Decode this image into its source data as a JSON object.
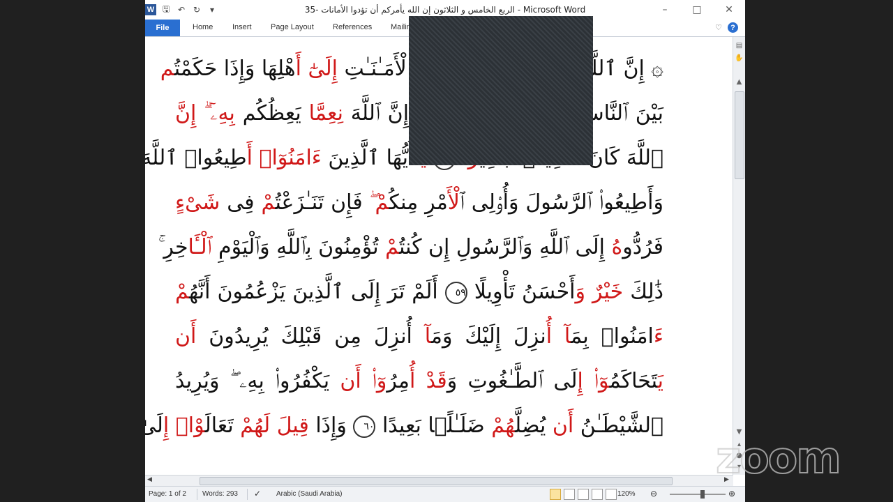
{
  "window": {
    "title": "الربع  الخامس و الثلاثون إن الله يأمركم أن تؤدوا الأمانات -35  -  Microsoft Word",
    "qat_icons": [
      "word-logo-icon",
      "save-icon",
      "undo-icon",
      "redo-icon",
      "customize-icon"
    ],
    "word_logo": "W"
  },
  "ribbon": {
    "file": "File",
    "tabs": [
      "Home",
      "Insert",
      "Page Layout",
      "References",
      "Mailings"
    ]
  },
  "document": {
    "lines": [
      {
        "spans": [
          {
            "t": "۞ إِنَّ ٱللَّهَ يَأْمُرُكُمْ أَن تُؤَدُّوا۟ ٱلْأَمَـٰنَـٰتِ ",
            "c": "k"
          },
          {
            "t": "إِلَىٰٓ أَ",
            "c": "r"
          },
          {
            "t": "هْلِهَا وَإِذَا حَكَمْتُ",
            "c": "k"
          },
          {
            "t": "م",
            "c": "r"
          }
        ]
      },
      {
        "spans": [
          {
            "t": "بَيْنَ ٱلنَّاسِ أَن تَحْكُمُوا۟ بِٱلْعَدْلِ ۚ إِنَّ ٱللَّهَ ",
            "c": "k"
          },
          {
            "t": "نِعِمَّا",
            "c": "r"
          },
          {
            "t": " يَعِظُكُم ",
            "c": "k"
          },
          {
            "t": "بِهِۦٓ ۗ إِنَّ",
            "c": "r"
          }
        ]
      },
      {
        "spans": [
          {
            "t": "ٱللَّهَ كَانَ سَمِيعًۢا بَصِي",
            "c": "k"
          },
          {
            "t": "رًا",
            "c": "r"
          },
          {
            "t": " ",
            "c": "k"
          },
          {
            "t": "٥٨",
            "c": "a"
          },
          {
            "t": " ",
            "c": "k"
          },
          {
            "t": "يَـٰٓ",
            "c": "r"
          },
          {
            "t": "أَيُّهَا ٱلَّذِينَ ",
            "c": "k"
          },
          {
            "t": "ءَامَنُوٓا۟ أَ",
            "c": "r"
          },
          {
            "t": "طِيعُوا۟ ٱللَّهَ",
            "c": "k"
          }
        ]
      },
      {
        "spans": [
          {
            "t": "وَأَطِيعُوا۟ ٱلرَّسُولَ وَأُو۟لِى ٱ",
            "c": "k"
          },
          {
            "t": "لْأَ",
            "c": "r"
          },
          {
            "t": "مْرِ مِنكُ",
            "c": "k"
          },
          {
            "t": "مْ ۖ",
            "c": "r"
          },
          {
            "t": " فَإِن تَنَـٰزَعْتُ",
            "c": "k"
          },
          {
            "t": "مْ",
            "c": "r"
          },
          {
            "t": " فِى ",
            "c": "k"
          },
          {
            "t": "شَىْءٍ",
            "c": "r"
          }
        ]
      },
      {
        "spans": [
          {
            "t": "فَرُدُّو",
            "c": "k"
          },
          {
            "t": "هُ",
            "c": "r"
          },
          {
            "t": " إِلَى ٱللَّهِ وَٱلرَّسُولِ إِن كُنتُ",
            "c": "k"
          },
          {
            "t": "مْ",
            "c": "r"
          },
          {
            "t": " تُؤْمِنُونَ بِٱللَّهِ وَٱلْيَوْمِ ",
            "c": "k"
          },
          {
            "t": "ٱلْـَٔا",
            "c": "r"
          },
          {
            "t": "خِرِ ۚ",
            "c": "k"
          }
        ]
      },
      {
        "spans": [
          {
            "t": "ذَٰلِكَ ",
            "c": "k"
          },
          {
            "t": "خَيْرٌ وَ",
            "c": "r"
          },
          {
            "t": "أَحْسَنُ تَأْوِيلًا ",
            "c": "k"
          },
          {
            "t": "٥٩",
            "c": "a"
          },
          {
            "t": " أَلَمْ تَرَ إِلَى ٱلَّذِينَ يَزْعُمُونَ أَنَّهُ",
            "c": "k"
          },
          {
            "t": "مْ",
            "c": "r"
          }
        ]
      },
      {
        "spans": [
          {
            "t": "ءَ",
            "c": "r"
          },
          {
            "t": "امَنُوا۟ بِمَ",
            "c": "k"
          },
          {
            "t": "آ أُ",
            "c": "r"
          },
          {
            "t": "نزِلَ إِلَيْكَ وَمَ",
            "c": "k"
          },
          {
            "t": "آ",
            "c": "r"
          },
          {
            "t": " أُنزِلَ مِن قَبْلِكَ يُرِيدُونَ ",
            "c": "k"
          },
          {
            "t": "أَن",
            "c": "r"
          }
        ]
      },
      {
        "spans": [
          {
            "t": "يَ",
            "c": "r"
          },
          {
            "t": "تَحَاكَمُ",
            "c": "k"
          },
          {
            "t": "وٓا۟ إِ",
            "c": "r"
          },
          {
            "t": "لَى ٱلطَّـٰغُوتِ وَ",
            "c": "k"
          },
          {
            "t": "قَدْ أُ",
            "c": "r"
          },
          {
            "t": "مِرُ",
            "c": "k"
          },
          {
            "t": "وٓا۟ أَن",
            "c": "r"
          },
          {
            "t": " يَكْفُرُوا۟ بِهِۦ ۖ وَيُرِيدُ",
            "c": "k"
          }
        ]
      },
      {
        "spans": [
          {
            "t": "ٱلشَّيْطَـٰنُ ",
            "c": "k"
          },
          {
            "t": "أَن",
            "c": "r"
          },
          {
            "t": " يُضِلَّ",
            "c": "k"
          },
          {
            "t": "هُمْ",
            "c": "r"
          },
          {
            "t": " ضَلَـٰلًۢا بَعِيدًا ",
            "c": "k"
          },
          {
            "t": "٦٠",
            "c": "a"
          },
          {
            "t": " وَإِذَا ",
            "c": "k"
          },
          {
            "t": "قِيلَ لَهُمْ",
            "c": "r"
          },
          {
            "t": " تَعَالَ",
            "c": "k"
          },
          {
            "t": "وْا۟ إِ",
            "c": "r"
          },
          {
            "t": "لَىٰ",
            "c": "k"
          }
        ]
      }
    ]
  },
  "statusbar": {
    "page": "Page: 1 of 2",
    "words": "Words: 293",
    "language": "Arabic (Saudi Arabia)",
    "zoom": "120%",
    "zoom_level_percent": 120
  },
  "watermark": "zoom",
  "colors": {
    "red_text": "#d01818",
    "file_tab": "#2a6fd1",
    "word_blue": "#2b579a"
  }
}
